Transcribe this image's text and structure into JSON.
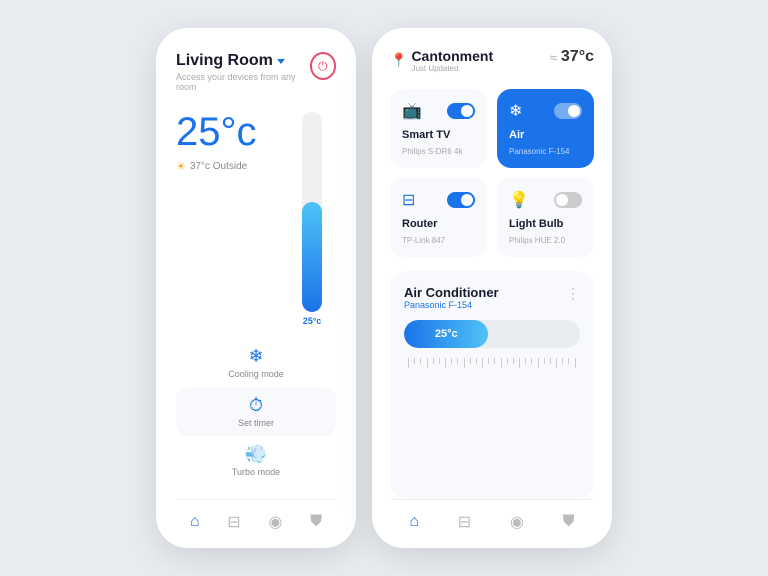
{
  "leftPhone": {
    "header": {
      "roomName": "Living Room",
      "subtitle": "Access your devices from any room"
    },
    "temperature": {
      "current": "25°c",
      "outside": "37°c Outside"
    },
    "thermometer": {
      "fillPercent": 55,
      "label": "25°c"
    },
    "modes": [
      {
        "id": "cooling",
        "label": "Cooling mode",
        "icon": "❄"
      },
      {
        "id": "timer",
        "label": "Set timer",
        "icon": "⏱"
      },
      {
        "id": "turbo",
        "label": "Turbo mode",
        "icon": "💨"
      }
    ],
    "nav": [
      {
        "id": "home",
        "icon": "⌂",
        "active": true
      },
      {
        "id": "wifi",
        "icon": "⊟",
        "active": false
      },
      {
        "id": "camera",
        "icon": "◉",
        "active": false
      },
      {
        "id": "shield",
        "icon": "⛊",
        "active": false
      }
    ]
  },
  "rightPhone": {
    "header": {
      "location": "Cantonment",
      "subtitle": "Just Updated",
      "temperature": "37°c"
    },
    "devices": [
      {
        "id": "tv",
        "name": "Smart TV",
        "model": "Philips S-DR6 4k",
        "icon": "📺",
        "active": false,
        "toggleOn": true
      },
      {
        "id": "air",
        "name": "Air",
        "model": "Panasonic F-154",
        "icon": "❄",
        "active": true,
        "toggleOn": true
      },
      {
        "id": "router",
        "name": "Router",
        "model": "TP-Link 847",
        "icon": "⊟",
        "active": false,
        "toggleOn": true
      },
      {
        "id": "bulb",
        "name": "Light Bulb",
        "model": "Philips HUE 2.0",
        "icon": "💡",
        "active": false,
        "toggleOn": false
      }
    ],
    "acSection": {
      "title": "Air Conditioner",
      "model": "Panasonic F-154",
      "sliderTemp": "25°c",
      "sliderFillPercent": 48
    },
    "nav": [
      {
        "id": "home",
        "icon": "⌂",
        "active": true
      },
      {
        "id": "wifi",
        "icon": "⊟",
        "active": false
      },
      {
        "id": "camera",
        "icon": "◉",
        "active": false
      },
      {
        "id": "shield",
        "icon": "⛊",
        "active": false
      }
    ]
  }
}
